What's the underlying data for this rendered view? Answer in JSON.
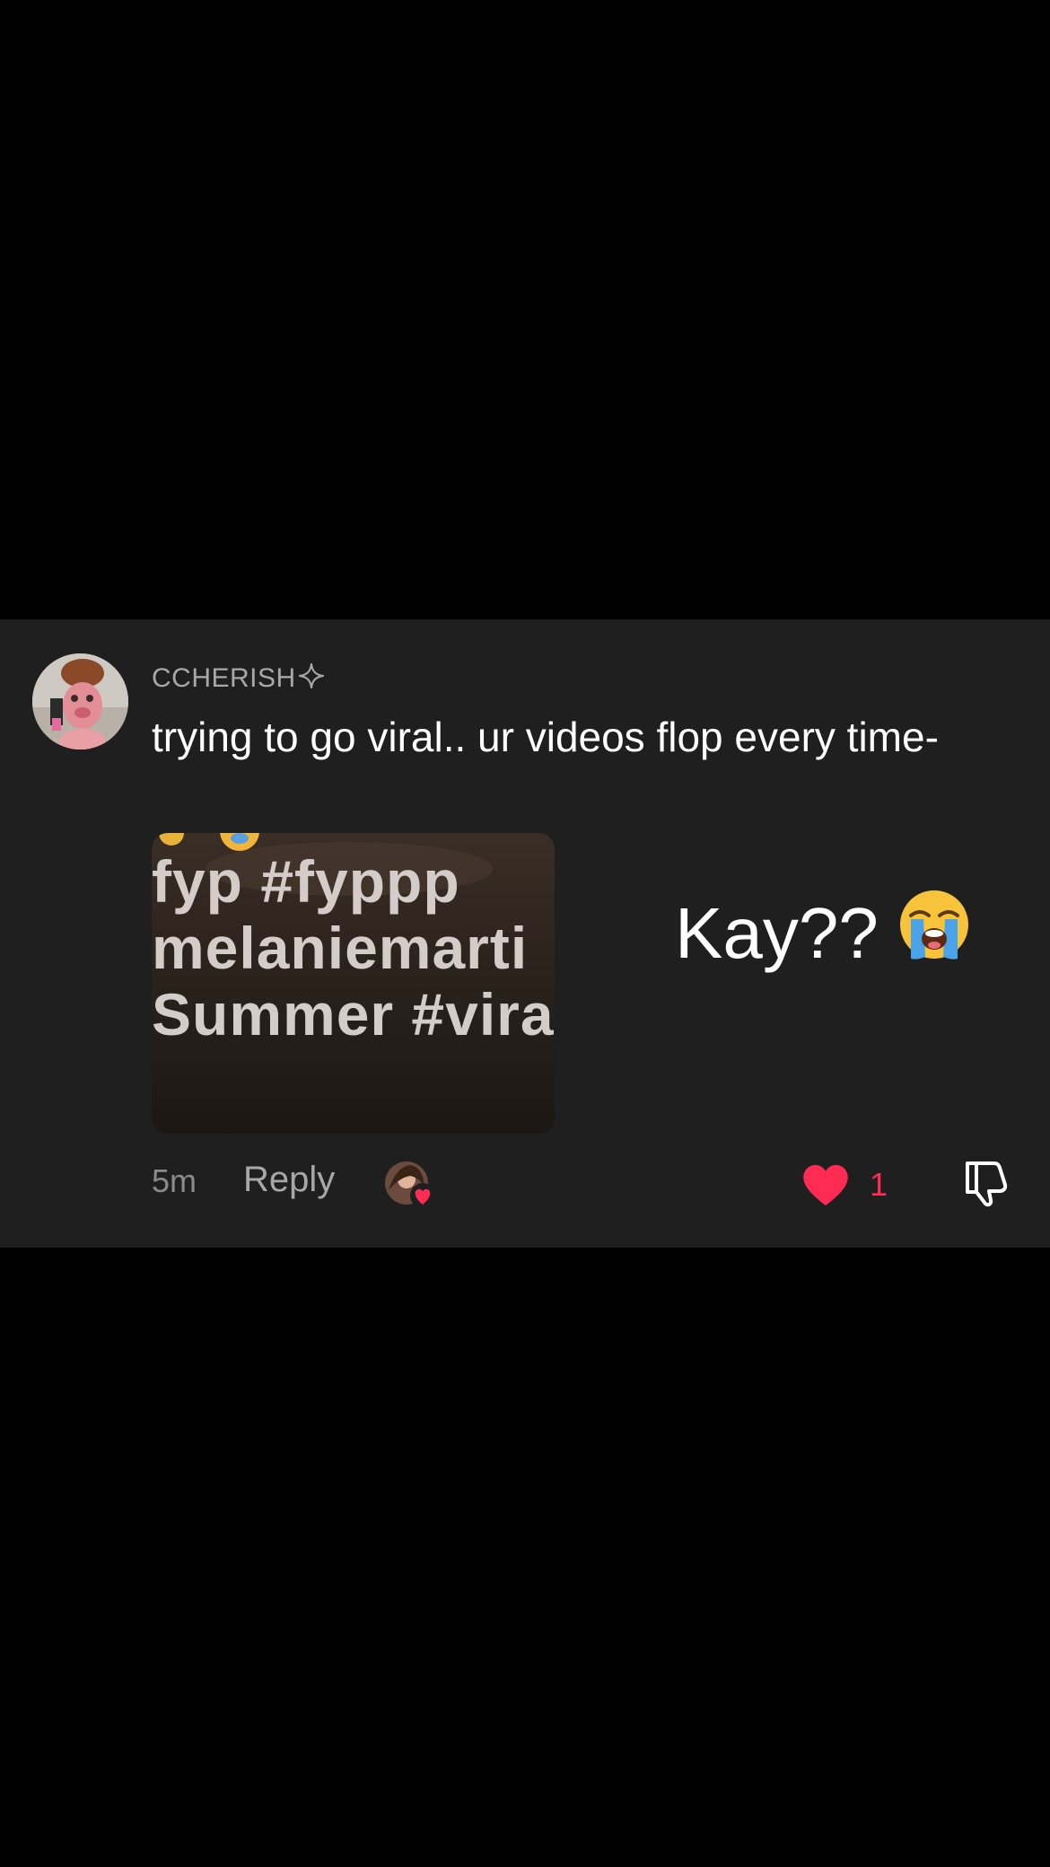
{
  "comment": {
    "username": "CCHERISH",
    "text": "trying to go viral.. ur videos flop every time-",
    "thumbnail_lines": [
      "fyp #fyppp",
      "melaniemarti",
      "Summer #vira"
    ],
    "reaction_text": "Kay??",
    "reaction_emoji": "😭",
    "time": "5m",
    "reply_label": "Reply",
    "like_count": "1"
  },
  "colors": {
    "card_bg": "#1f1f1f",
    "page_bg": "#000000",
    "like_red": "#fe2c55",
    "muted": "#a8a8a8"
  },
  "icons": {
    "username_badge": "sparkle-icon",
    "like": "heart-icon",
    "dislike": "thumbs-down-icon",
    "liker": "creator-liked-avatar-icon"
  }
}
